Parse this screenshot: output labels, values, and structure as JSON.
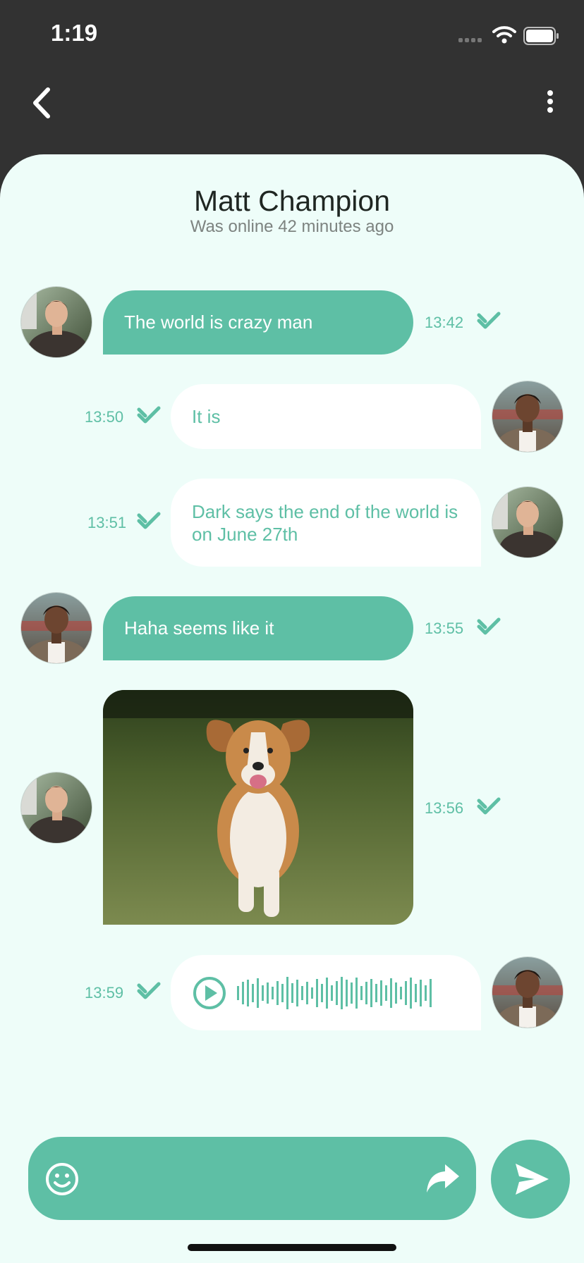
{
  "status_bar": {
    "time": "1:19"
  },
  "header": {
    "contact_name": "Matt Champion",
    "contact_status": "Was online 42 minutes ago"
  },
  "messages": [
    {
      "direction": "incoming",
      "type": "text",
      "text": "The world is crazy man",
      "time": "13:42",
      "avatar": "avatar-matt"
    },
    {
      "direction": "outgoing",
      "type": "text",
      "text": "It is",
      "time": "13:50",
      "avatar": "avatar-other"
    },
    {
      "direction": "outgoing",
      "type": "text",
      "text": "Dark says the end of the world is on June 27th",
      "time": "13:51",
      "avatar": "avatar-matt"
    },
    {
      "direction": "incoming",
      "type": "text",
      "text": "Haha seems like it",
      "time": "13:55",
      "avatar": "avatar-other"
    },
    {
      "direction": "incoming",
      "type": "image",
      "image": "running-dog-photo",
      "time": "13:56",
      "avatar": "avatar-matt"
    },
    {
      "direction": "outgoing",
      "type": "voice",
      "time": "13:59",
      "avatar": "avatar-other"
    }
  ],
  "icons": {
    "back": "chevron-left-icon",
    "more": "more-vertical-icon",
    "read": "double-check-icon",
    "play": "play-circle-icon",
    "waveform": "audio-waveform-icon",
    "emoji": "smiley-icon",
    "forward": "forward-arrow-icon",
    "send": "send-icon"
  },
  "colors": {
    "accent": "#5ebfa5",
    "background": "#eefdf9",
    "header": "#323232",
    "outgoing_bubble": "#ffffff"
  }
}
